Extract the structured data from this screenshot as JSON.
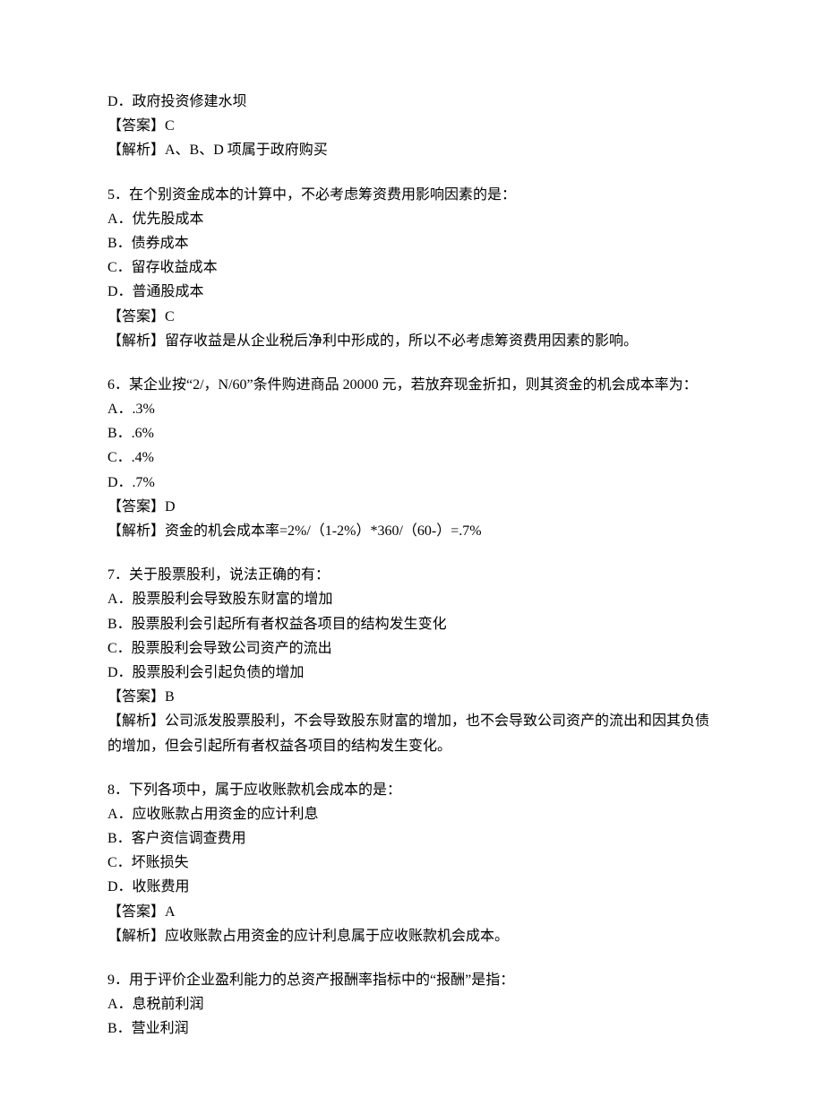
{
  "q4tail": {
    "optionD": "D．政府投资修建水坝",
    "answer": "【答案】C",
    "explain": "【解析】A、B、D 项属于政府购买"
  },
  "q5": {
    "stem": "5．在个别资金成本的计算中，不必考虑筹资费用影响因素的是：",
    "A": "A．优先股成本",
    "B": "B．债券成本",
    "C": "C．留存收益成本",
    "D": "D．普通股成本",
    "answer": "【答案】C",
    "explain": "【解析】留存收益是从企业税后净利中形成的，所以不必考虑筹资费用因素的影响。"
  },
  "q6": {
    "stem": "6．某企业按“2/，N/60”条件购进商品 20000 元，若放弃现金折扣，则其资金的机会成本率为：",
    "A": "A．.3%",
    "B": "B．.6%",
    "C": "C．.4%",
    "D": "D．.7%",
    "answer": "【答案】D",
    "explain": "【解析】资金的机会成本率=2%/（1-2%）*360/（60-）=.7%"
  },
  "q7": {
    "stem": "7．关于股票股利，说法正确的有：",
    "A": "A．股票股利会导致股东财富的增加",
    "B": "B．股票股利会引起所有者权益各项目的结构发生变化",
    "C": "C．股票股利会导致公司资产的流出",
    "D": "D．股票股利会引起负债的增加",
    "answer": "【答案】B",
    "explain": "【解析】公司派发股票股利，不会导致股东财富的增加，也不会导致公司资产的流出和因其负债的增加，但会引起所有者权益各项目的结构发生变化。"
  },
  "q8": {
    "stem": "8．下列各项中，属于应收账款机会成本的是：",
    "A": "A．应收账款占用资金的应计利息",
    "B": "B．客户资信调查费用",
    "C": "C．坏账损失",
    "D": "D．收账费用",
    "answer": "【答案】A",
    "explain": "【解析】应收账款占用资金的应计利息属于应收账款机会成本。"
  },
  "q9": {
    "stem": "9．用于评价企业盈利能力的总资产报酬率指标中的“报酬”是指：",
    "A": "A．息税前利润",
    "B": "B．营业利润"
  }
}
